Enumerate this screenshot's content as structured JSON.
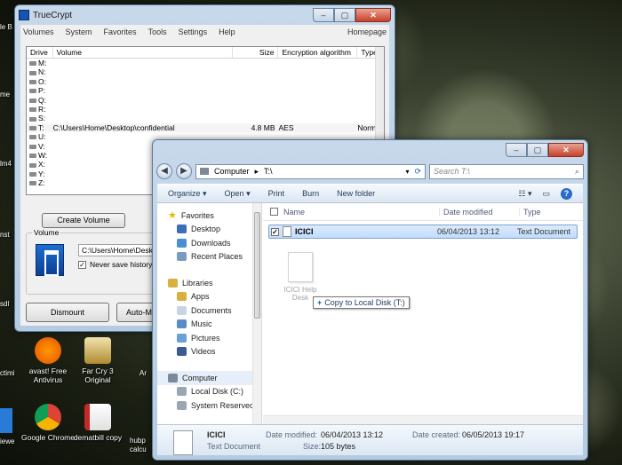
{
  "desktop": {
    "icons": [
      {
        "label": "avast! Free Antivirus",
        "color": "#f57c00"
      },
      {
        "label": "Far Cry 3 Original",
        "color": "#c8a040"
      },
      {
        "label": "Google Chrome",
        "color": "#3a8b3a"
      },
      {
        "label": "dematbill copy",
        "color": "#c62828"
      }
    ],
    "edge_labels": [
      "le B",
      "me",
      "lm4",
      "nst",
      "sdl",
      "ctimi",
      "iewe",
      "Ar",
      "hubp calcu"
    ]
  },
  "truecrypt": {
    "title": "TrueCrypt",
    "menu": [
      "Volumes",
      "System",
      "Favorites",
      "Tools",
      "Settings",
      "Help"
    ],
    "homepage": "Homepage",
    "columns": {
      "drive": "Drive",
      "volume": "Volume",
      "size": "Size",
      "algorithm": "Encryption algorithm",
      "type": "Type"
    },
    "drives": [
      {
        "drive": "M:",
        "volume": "",
        "size": "",
        "algorithm": "",
        "type": ""
      },
      {
        "drive": "N:",
        "volume": "",
        "size": "",
        "algorithm": "",
        "type": ""
      },
      {
        "drive": "O:",
        "volume": "",
        "size": "",
        "algorithm": "",
        "type": ""
      },
      {
        "drive": "P:",
        "volume": "",
        "size": "",
        "algorithm": "",
        "type": ""
      },
      {
        "drive": "Q:",
        "volume": "",
        "size": "",
        "algorithm": "",
        "type": ""
      },
      {
        "drive": "R:",
        "volume": "",
        "size": "",
        "algorithm": "",
        "type": ""
      },
      {
        "drive": "S:",
        "volume": "",
        "size": "",
        "algorithm": "",
        "type": ""
      },
      {
        "drive": "T:",
        "volume": "C:\\Users\\Home\\Desktop\\confidential",
        "size": "4.8 MB",
        "algorithm": "AES",
        "type": "Normal"
      },
      {
        "drive": "U:",
        "volume": "",
        "size": "",
        "algorithm": "",
        "type": ""
      },
      {
        "drive": "V:",
        "volume": "",
        "size": "",
        "algorithm": "",
        "type": ""
      },
      {
        "drive": "W:",
        "volume": "",
        "size": "",
        "algorithm": "",
        "type": ""
      },
      {
        "drive": "X:",
        "volume": "",
        "size": "",
        "algorithm": "",
        "type": ""
      },
      {
        "drive": "Y:",
        "volume": "",
        "size": "",
        "algorithm": "",
        "type": ""
      },
      {
        "drive": "Z:",
        "volume": "",
        "size": "",
        "algorithm": "",
        "type": ""
      }
    ],
    "create_volume": "Create Volume",
    "volume_group_label": "Volume",
    "volume_path": "C:\\Users\\Home\\Desktop\\confid",
    "never_save_history": "Never save history",
    "dismount": "Dismount",
    "auto_mount": "Auto-Mo"
  },
  "explorer": {
    "address": {
      "computer": "Computer",
      "sep": "▸",
      "drive": "T:\\"
    },
    "search_placeholder": "Search T:\\",
    "toolbar": {
      "organize": "Organize ▾",
      "open": "Open ▾",
      "print": "Print",
      "burn": "Burn",
      "new_folder": "New folder"
    },
    "nav": {
      "favorites": "Favorites",
      "favorites_items": [
        "Desktop",
        "Downloads",
        "Recent Places"
      ],
      "libraries": "Libraries",
      "libraries_items": [
        "Apps",
        "Documents",
        "Music",
        "Pictures",
        "Videos"
      ],
      "computer": "Computer",
      "computer_items": [
        "Local Disk (C:)",
        "System Reserved"
      ]
    },
    "columns": {
      "name": "Name",
      "date": "Date modified",
      "type": "Type"
    },
    "files": [
      {
        "name": "ICICI",
        "date": "06/04/2013 13:12",
        "type": "Text Document"
      }
    ],
    "ghost_label": "ICICI Help Desk",
    "drag_tip": "Copy to Local Disk (T:)",
    "details": {
      "name": "ICICI",
      "kind": "Text Document",
      "date_modified_label": "Date modified:",
      "date_modified": "06/04/2013 13:12",
      "date_created_label": "Date created:",
      "date_created": "06/05/2013 19:17",
      "size_label": "Size:",
      "size": "105 bytes"
    }
  }
}
